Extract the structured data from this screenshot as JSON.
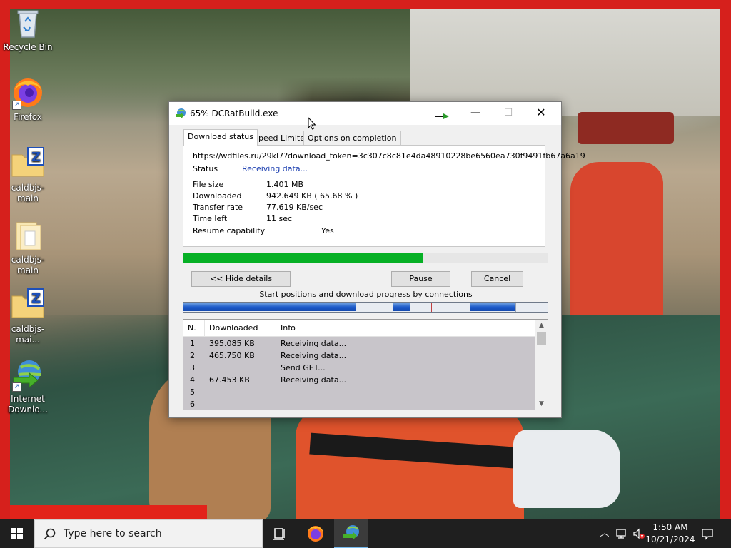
{
  "desktop": {
    "icons": [
      {
        "label": "Recycle Bin",
        "icon": "recycle-bin-icon"
      },
      {
        "label": "Firefox",
        "icon": "firefox-icon"
      },
      {
        "label": "caldbjs-main",
        "icon": "zip-folder-icon"
      },
      {
        "label": "caldbjs-main",
        "icon": "folder-icon"
      },
      {
        "label": "caldbjs-mai...",
        "icon": "zip-folder-icon"
      },
      {
        "label": "Internet Downlo...",
        "icon": "internet-download-manager-icon"
      }
    ]
  },
  "dialog": {
    "title": "65% DCRatBuild.exe",
    "tabs": [
      "Download status",
      "Speed Limiter",
      "Options on completion"
    ],
    "active_tab": "Download status",
    "url": "https://wdfiles.ru/29kI7?download_token=3c307c8c81e4da48910228be6560ea730f9491fb67a6a19",
    "status": {
      "label": "Status",
      "value": "Receiving data..."
    },
    "info": [
      {
        "label": "File size",
        "value": "1.401  MB"
      },
      {
        "label": "Downloaded",
        "value": "942.649  KB  ( 65.68 % )"
      },
      {
        "label": "Transfer rate",
        "value": "77.619  KB/sec"
      },
      {
        "label": "Time left",
        "value": "11 sec"
      },
      {
        "label": "Resume capability",
        "value": "Yes"
      }
    ],
    "progress_percent": 65.68,
    "buttons": {
      "hide_details": "<< Hide details",
      "pause": "Pause",
      "cancel": "Cancel"
    },
    "connections_caption": "Start positions and download progress by connections",
    "table": {
      "headers": [
        "N.",
        "Downloaded",
        "Info"
      ],
      "rows": [
        {
          "n": "1",
          "downloaded": "395.085  KB",
          "info": "Receiving data..."
        },
        {
          "n": "2",
          "downloaded": "465.750  KB",
          "info": "Receiving data..."
        },
        {
          "n": "3",
          "downloaded": "",
          "info": "Send GET..."
        },
        {
          "n": "4",
          "downloaded": "67.453  KB",
          "info": "Receiving data..."
        },
        {
          "n": "5",
          "downloaded": "",
          "info": ""
        },
        {
          "n": "6",
          "downloaded": "",
          "info": ""
        }
      ]
    }
  },
  "taskbar": {
    "search_placeholder": "Type here to search",
    "time": "1:50 AM",
    "date": "10/21/2024"
  },
  "colors": {
    "progress_green": "#06b025",
    "status_blue": "#1c3fb0",
    "frame_red": "#d6201c"
  }
}
